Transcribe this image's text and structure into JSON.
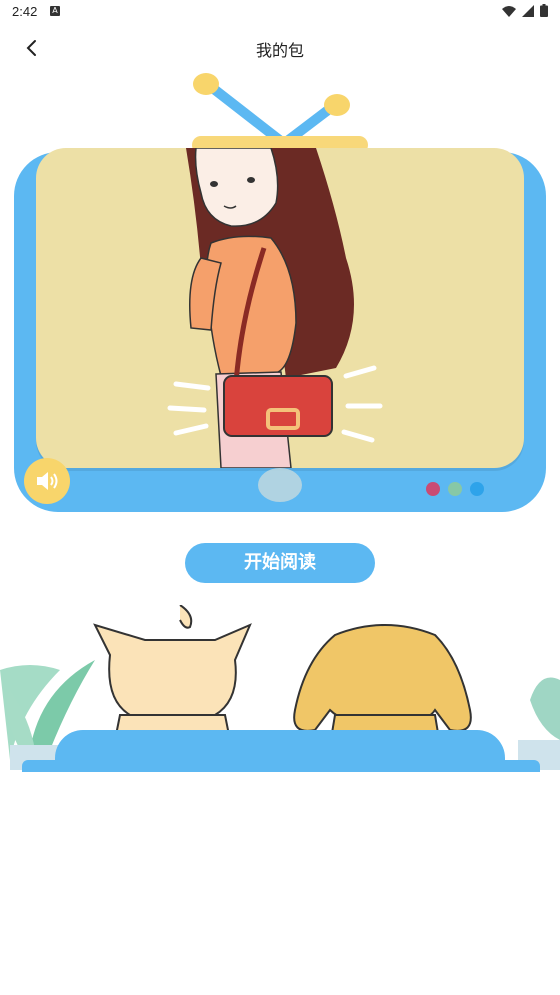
{
  "status_bar": {
    "time": "2:42"
  },
  "header": {
    "title": "我的包"
  },
  "story": {
    "read_label": "开始阅读"
  },
  "colors": {
    "accent": "#5cb8f2",
    "speaker": "#f8d56b",
    "screen": "#ede0a6",
    "dot1": "#c94b74",
    "dot2": "#87c8a6",
    "dot3": "#2ea3ea"
  },
  "icons": {
    "back": "chevron-left-icon",
    "speaker": "speaker-icon"
  }
}
